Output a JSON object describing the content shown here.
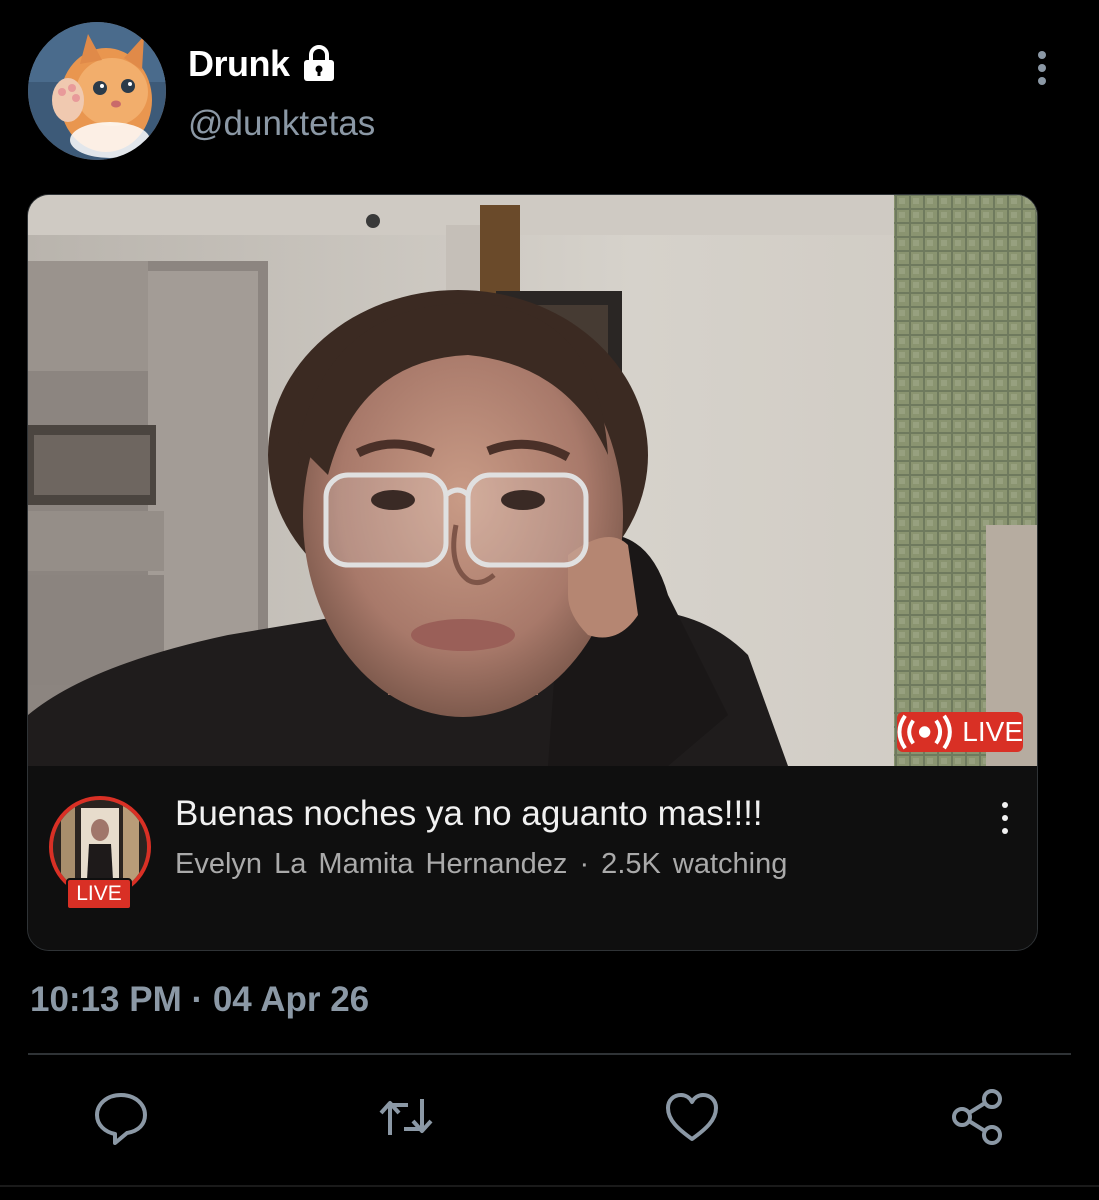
{
  "author": {
    "display_name": "Drunk",
    "handle": "@dunktetas",
    "avatar_icon": "kitten-avatar",
    "protected_icon": "lock-icon"
  },
  "media": {
    "live_badge_label": "LIVE",
    "stream": {
      "title": "Buenas noches ya no aguanto mas!!!!",
      "meta": "Evelyn  La Mamita Hernandez · 2.5K watching",
      "channel_live_tag": "LIVE"
    }
  },
  "timestamp": "10:13 PM · 04 Apr 26",
  "actions": [
    "reply-icon",
    "retweet-icon",
    "like-icon",
    "share-icon"
  ],
  "colors": {
    "background": "#000000",
    "secondary_text": "#8b98a5",
    "live_red": "#d93025"
  }
}
